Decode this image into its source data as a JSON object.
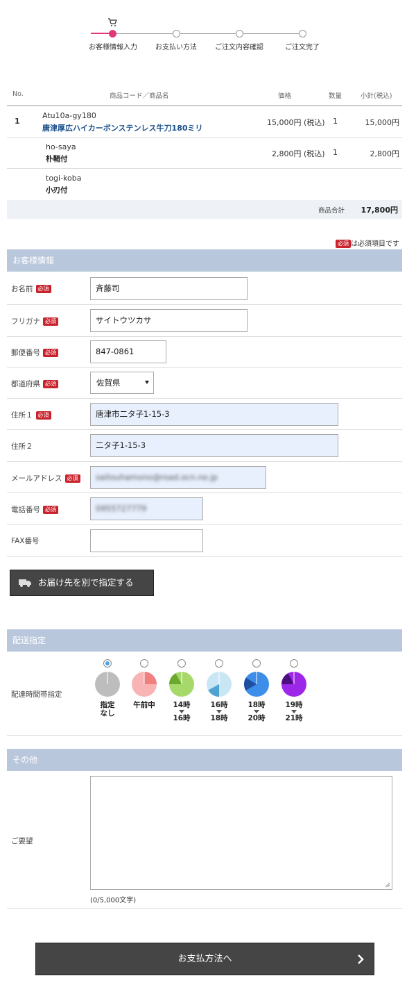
{
  "steps": [
    {
      "label": "お客様情報入力",
      "active": true
    },
    {
      "label": "お支払い方法",
      "active": false
    },
    {
      "label": "ご注文内容確認",
      "active": false
    },
    {
      "label": "ご注文完了",
      "active": false
    }
  ],
  "cart": {
    "headers": {
      "no": "No.",
      "name": "商品コード／商品名",
      "price": "価格",
      "qty": "数量",
      "subtotal": "小計(税込)"
    },
    "item": {
      "no": "1",
      "code": "Atu10a-gy180",
      "name": "唐津厚広ハイカーボンステンレス牛刀180ミリ",
      "price": "15,000円 (税込)",
      "qty": "1",
      "subtotal": "15,000円"
    },
    "option1": {
      "code": "ho-saya",
      "name": "朴鞘付",
      "price": "2,800円 (税込)",
      "qty": "1",
      "subtotal": "2,800円"
    },
    "option2": {
      "code": "togi-koba",
      "name": "小刃付"
    },
    "total_label": "商品合計",
    "total_value": "17,800円"
  },
  "required_note": {
    "badge": "必須",
    "text": "は必須項目です"
  },
  "customer": {
    "title": "お客様情報",
    "badge": "必須",
    "name": {
      "label": "お名前",
      "value": "斉藤司"
    },
    "furigana": {
      "label": "フリガナ",
      "value": "サイトウツカサ"
    },
    "zip": {
      "label": "郵便番号",
      "value": "847-0861"
    },
    "pref": {
      "label": "都道府県",
      "value": "佐賀県"
    },
    "address1": {
      "label": "住所１",
      "value": "唐津市二タ子1-15-3"
    },
    "address2": {
      "label": "住所２",
      "value": "二タ子1-15-3"
    },
    "email": {
      "label": "メールアドレス",
      "value": "saitouhamono@road.ocn.ne.jp"
    },
    "phone": {
      "label": "電話番号",
      "value": "0955727779"
    },
    "fax": {
      "label": "FAX番号",
      "value": ""
    },
    "ship_button": "お届け先を別で指定する"
  },
  "delivery": {
    "title": "配送指定",
    "label": "配達時間帯指定",
    "slots": [
      {
        "line1": "指定",
        "line2": "なし",
        "line3": "",
        "selected": true,
        "color": "#bdbdbd",
        "accent": "#9e9e9e",
        "fraction": 0
      },
      {
        "line1": "午前中",
        "line2": "",
        "line3": "",
        "selected": false,
        "color": "#f8b4b4",
        "accent": "#f07f7f",
        "fraction": 0.25
      },
      {
        "line1": "14時",
        "line2": "16時",
        "line3": "",
        "selected": false,
        "color": "#a6d96a",
        "accent": "#6aa82e",
        "fraction": 0.17
      },
      {
        "line1": "16時",
        "line2": "18時",
        "line3": "",
        "selected": false,
        "color": "#c9e6f5",
        "accent": "#4fa3d1",
        "fraction": 0.17
      },
      {
        "line1": "18時",
        "line2": "20時",
        "line3": "",
        "selected": false,
        "color": "#3d8ee8",
        "accent": "#1f4fa0",
        "fraction": 0.17
      },
      {
        "line1": "19時",
        "line2": "21時",
        "line3": "",
        "selected": false,
        "color": "#9c27e8",
        "accent": "#4b0f80",
        "fraction": 0.17
      }
    ]
  },
  "other": {
    "title": "その他",
    "label": "ご要望",
    "counter": "(0/5,000文字)"
  },
  "next_button": "お支払方法へ",
  "colors": {
    "accent": "#e0397a",
    "section": "#b9c7dc",
    "required": "#c9232d",
    "link": "#1a4f8b",
    "button": "#454545"
  }
}
